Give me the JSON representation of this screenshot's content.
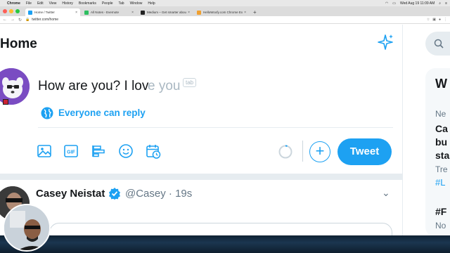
{
  "menubar": {
    "app": "Chrome",
    "items": [
      "File",
      "Edit",
      "View",
      "History",
      "Bookmarks",
      "People",
      "Tab",
      "Window",
      "Help"
    ],
    "clock": "Wed Aug 19  11:09 AM"
  },
  "tabs": [
    {
      "title": "Home / Twitter",
      "favicon_color": "#1da1f2",
      "active": true
    },
    {
      "title": "All Notes - Evernote",
      "favicon_color": "#2dbe60",
      "active": false
    },
    {
      "title": "Medium – Get smarter about w",
      "favicon_color": "#222222",
      "active": false
    },
    {
      "title": "HelloWoofy.com Chrome Exte",
      "favicon_color": "#f0a030",
      "active": false
    }
  ],
  "address": {
    "url": "twitter.com/home"
  },
  "header": {
    "title": "Home"
  },
  "compose": {
    "typed_text": "How are you? I lov",
    "suggestion": "e you",
    "tab_hint": "tab",
    "reply_setting": "Everyone can reply",
    "toolbar_icons": [
      "image-icon",
      "gif-icon",
      "poll-icon",
      "emoji-icon",
      "schedule-icon"
    ],
    "tweet_label": "Tweet",
    "add_label": "+"
  },
  "tweet": {
    "name": "Casey Neistat",
    "handle": "@Casey",
    "time": "· 19s",
    "caret": "⌄"
  },
  "right": {
    "trend_lines": [
      "W",
      "Ne",
      "Ca",
      "bu",
      "sta",
      "Tre",
      "#L",
      "#F",
      "No"
    ]
  },
  "colors": {
    "accent": "#1da1f2",
    "text": "#14171a",
    "secondary": "#657786",
    "suggestion": "#aab8c2"
  }
}
